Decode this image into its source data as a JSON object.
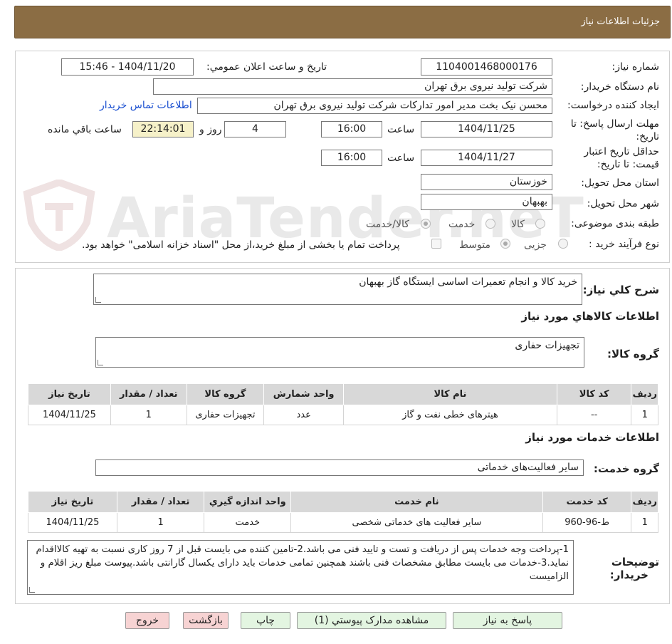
{
  "page_title": "جزئيات اطلاعات نياز",
  "watermark": "AriaTender.neT",
  "form": {
    "need_number_label": "شماره نیاز:",
    "need_number": "1104001468000176",
    "announce_label": "تاريخ و ساعت اعلان عمومي:",
    "announce_value": "1404/11/20 - 15:46",
    "buyer_label": "نام دستگاه خريدار:",
    "buyer_value": "شرکت تولید نیروی برق تهران",
    "creator_label": "ايجاد کننده درخواست:",
    "creator_value": "محسن نیک بخت مدیر امور تدارکات شرکت تولید نیروی برق تهران",
    "contact_link": "اطلاعات تماس خریدار",
    "deadline_label_1": "مهلت ارسال پاسخ: تا",
    "deadline_label_2": "تاريخ:",
    "deadline_date": "1404/11/25",
    "time_label": "ساعت",
    "deadline_time": "16:00",
    "days_value": "4",
    "days_label": "روز و",
    "remaining_time": "22:14:01",
    "remaining_label": "ساعت باقي مانده",
    "validity_label_1": "حداقل تاريخ اعتبار",
    "validity_label_2": "قيمت: تا تاريخ:",
    "validity_date": "1404/11/27",
    "validity_time": "16:00",
    "province_label": "استان محل تحویل:",
    "province_value": "خوزستان",
    "city_label": "شهر محل تحویل:",
    "city_value": "بهبهان",
    "category_label": "طبقه بندی موضوعی:",
    "category_options": [
      "کالا",
      "خدمت",
      "کالا/خدمت"
    ],
    "category_selected": "کالا/خدمت",
    "process_label": "نوع فرآیند خرید :",
    "process_options": [
      "جزیی",
      "متوسط"
    ],
    "process_selected": "متوسط",
    "payment_note": "پرداخت تمام یا بخشی از مبلغ خرید،از محل \"اسناد خزانه اسلامی\" خواهد بود."
  },
  "summary": {
    "label": "شرح کلي نياز:",
    "value": "خرید کالا و انجام تعمیرات اساسی ایستگاه گاز بهبهان"
  },
  "goods": {
    "section_title": "اطلاعات کالاهاي مورد نياز",
    "group_label": "گروه کالا:",
    "group_value": "تجهیزات حفاری",
    "headers": [
      "رديف",
      "کد کالا",
      "نام کالا",
      "واحد شمارش",
      "گروه کالا",
      "تعداد / مقدار",
      "تاريخ نياز"
    ],
    "rows": [
      [
        "1",
        "--",
        "هیترهای خطی نفت و گاز",
        "عدد",
        "تجهیزات حفاری",
        "1",
        "1404/11/25"
      ]
    ]
  },
  "services": {
    "section_title": "اطلاعات خدمات مورد نياز",
    "group_label": "گروه خدمت:",
    "group_value": "سایر فعالیت‌های خدماتی",
    "headers": [
      "رديف",
      "کد خدمت",
      "نام خدمت",
      "واحد اندازه گيري",
      "تعداد / مقدار",
      "تاريخ نياز"
    ],
    "rows": [
      [
        "1",
        "ط-96-960",
        "سایر فعالیت های خدماتی شخصی",
        "خدمت",
        "1",
        "1404/11/25"
      ]
    ]
  },
  "notes": {
    "label_1": "توضیحات",
    "label_2": "خریدار:",
    "value": "1-پرداخت وجه خدمات پس از دریافت و تست و تایید فنی می باشد.2-تامین کننده می بایست قبل از 7 روز کاری نسبت به تهیه کالااقدام نماید.3-خدمات می بایست مطابق مشخصات فنی باشند همچنین تمامی خدمات باید دارای یکسال گارانتی باشد.پیوست مبلغ ریز اقلام و الزامیست"
  },
  "buttons": {
    "reply": "پاسخ به نياز",
    "attachments": "مشاهده مدارک پيوستي (1)",
    "print": "چاپ",
    "back": "بازگشت",
    "exit": "خروج"
  },
  "colors": {
    "title_bar": "#8b6d44",
    "green_button": "#e3f5e1",
    "pink_button": "#f7d3d3",
    "remaining_bg": "#f6f1c9",
    "link": "#1a4fd0"
  }
}
